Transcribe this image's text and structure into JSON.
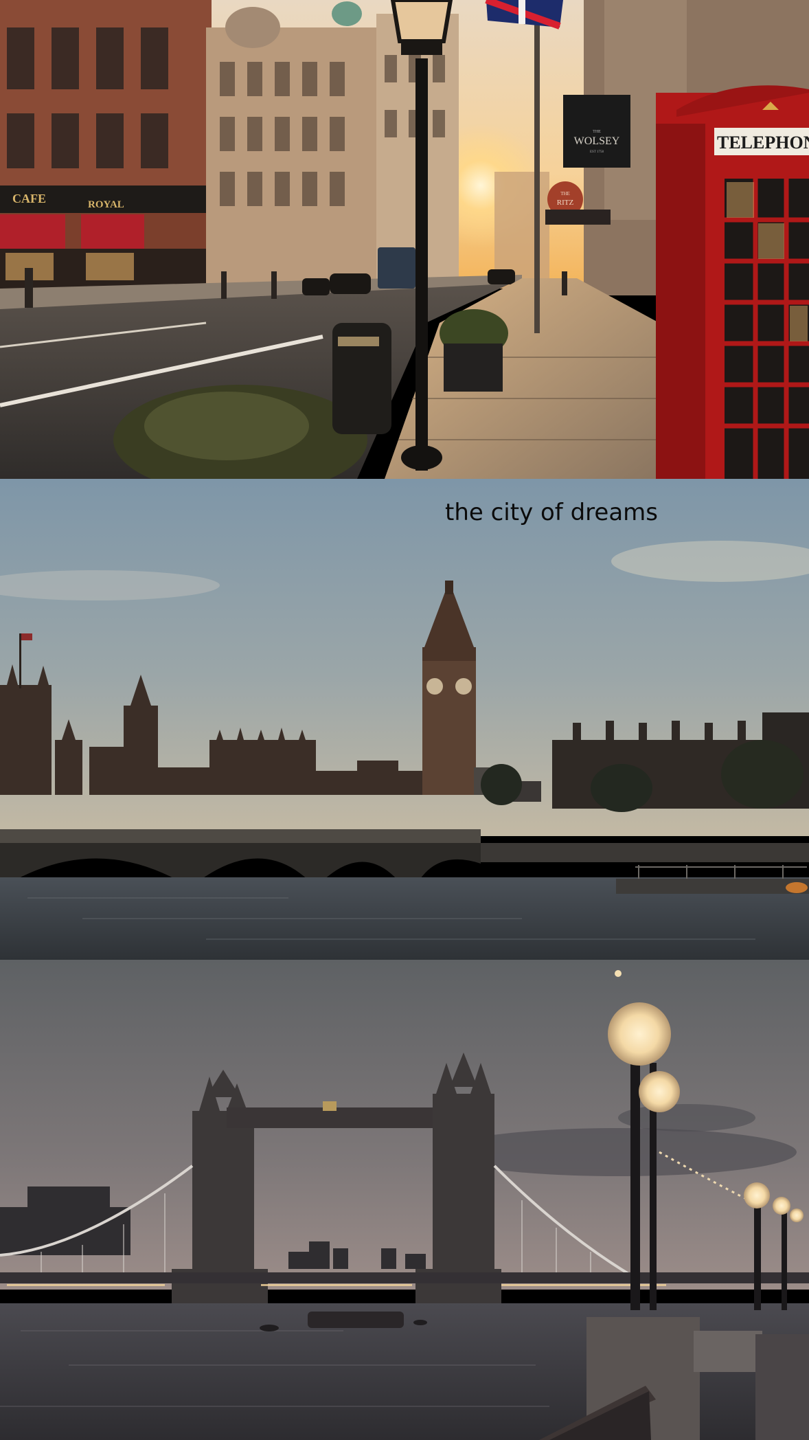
{
  "caption": "the city of dreams",
  "panels": {
    "street": {
      "signs": {
        "cafe_left": "CAFE",
        "cafe_right": "ROYAL",
        "wolsey_main": "WOLSEY",
        "wolsey_small": "THE",
        "wolsey_est": "EST 1758",
        "ritz_top": "THE",
        "ritz_main": "RITZ",
        "telephone": "TELEPHON"
      }
    },
    "westminster": {},
    "tower_bridge": {}
  },
  "colors": {
    "sunset_sky": "#f3d5a7",
    "phone_box_red": "#b01818",
    "dusk_sky": "#8c98a1",
    "evening_sky": "#6f6c72"
  }
}
